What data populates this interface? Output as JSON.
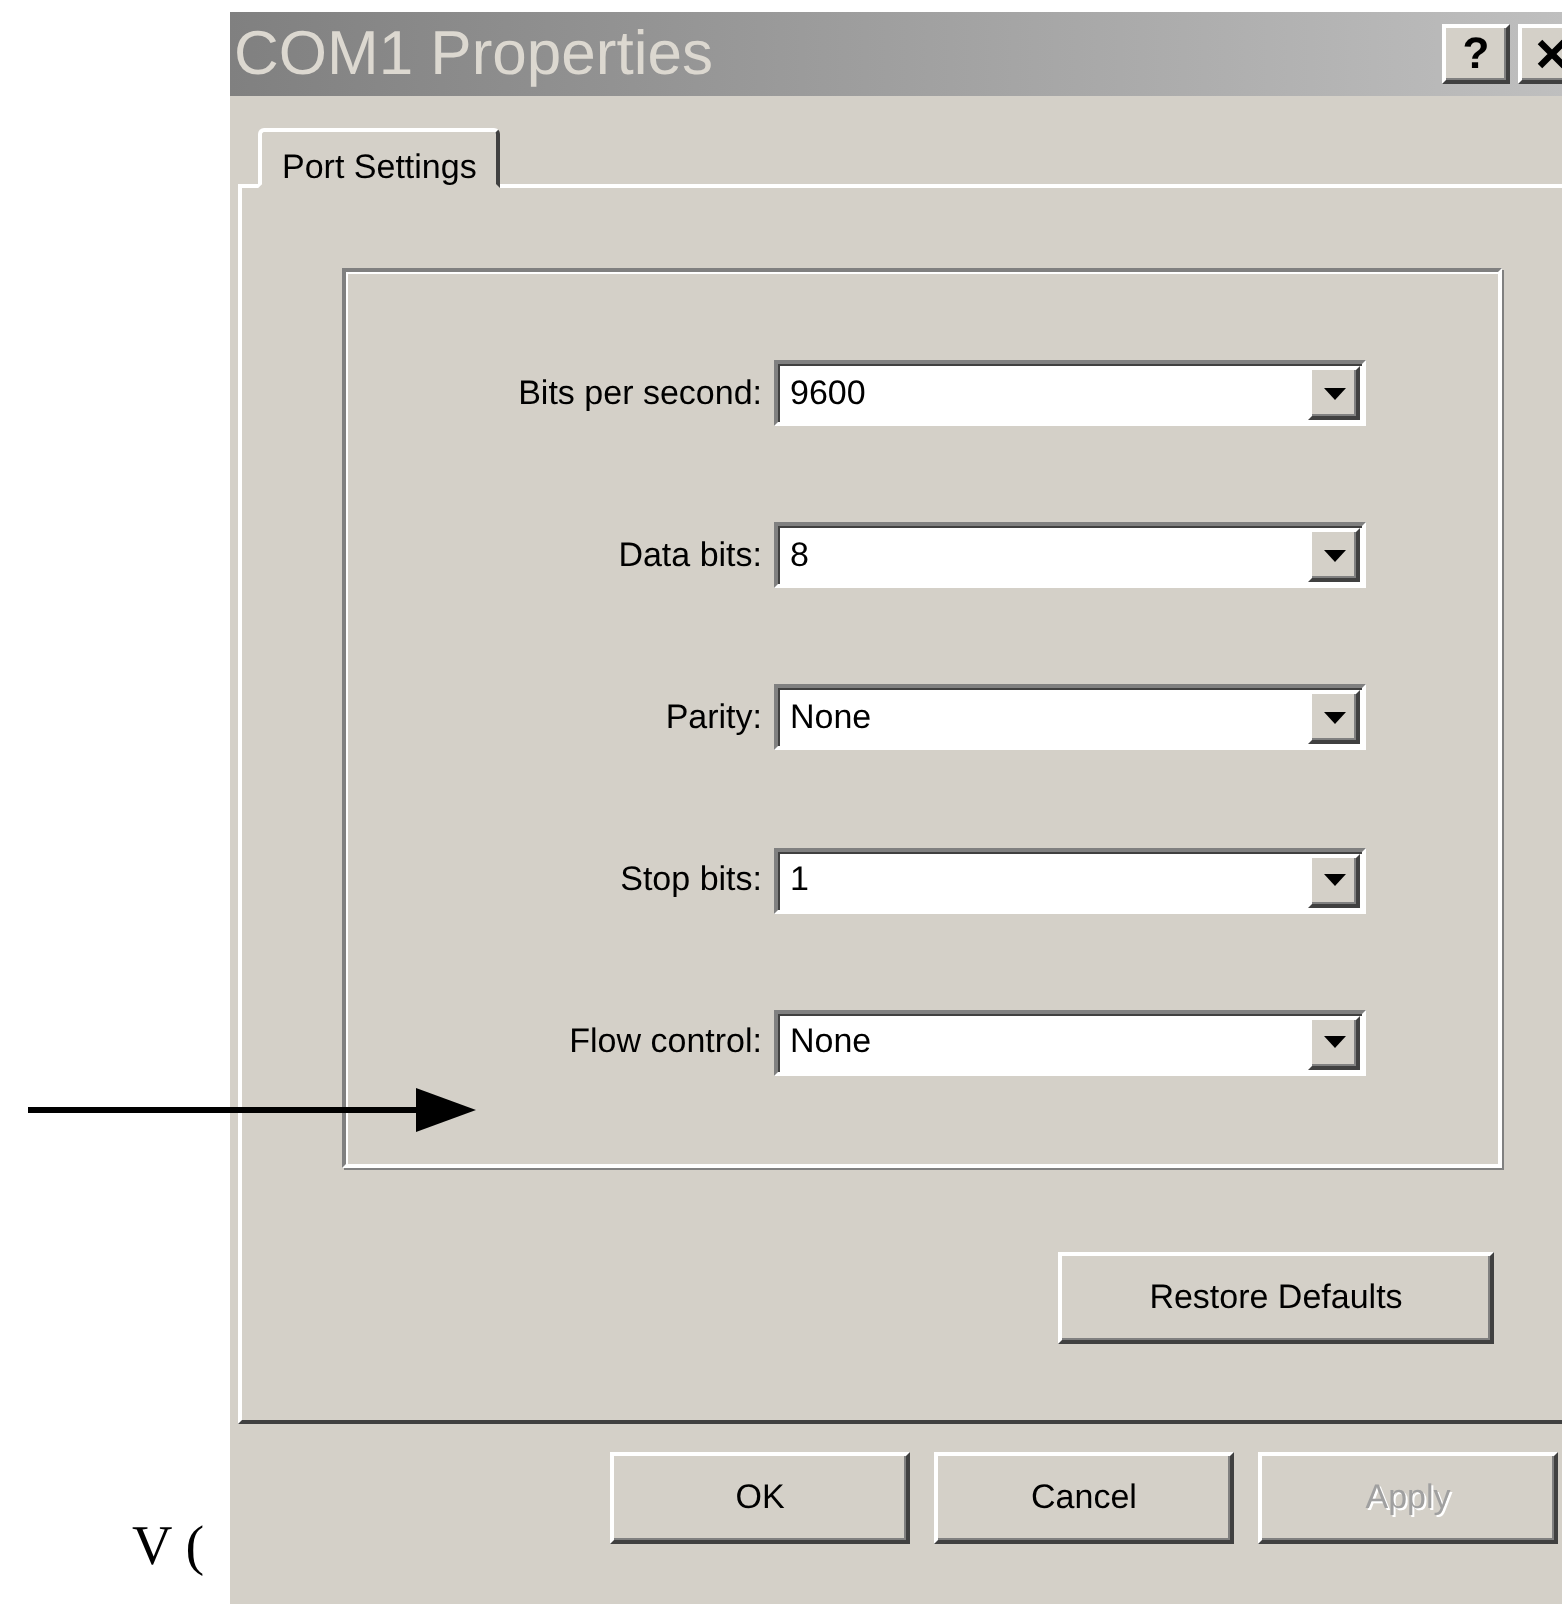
{
  "window": {
    "title": "COM1 Properties",
    "help_button": "?"
  },
  "tabs": [
    {
      "label": "Port Settings",
      "selected": true
    }
  ],
  "settings": [
    {
      "label": "Bits per second:",
      "value": "9600"
    },
    {
      "label": "Data bits:",
      "value": "8"
    },
    {
      "label": "Parity:",
      "value": "None"
    },
    {
      "label": "Stop bits:",
      "value": "1"
    },
    {
      "label": "Flow control:",
      "value": "None"
    }
  ],
  "restore_button": "Restore Defaults",
  "buttons": [
    {
      "label": "OK",
      "disabled": false
    },
    {
      "label": "Cancel",
      "disabled": false
    },
    {
      "label": "Apply",
      "disabled": true
    }
  ],
  "annotation": {
    "text": "V ("
  }
}
